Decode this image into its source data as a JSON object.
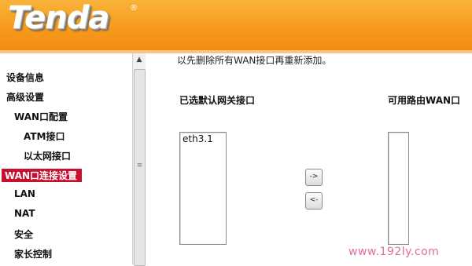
{
  "header": {
    "logo_text": "Tenda",
    "reg_mark": "®"
  },
  "sidebar": {
    "items": [
      {
        "label": "设备信息"
      },
      {
        "label": "高级设置"
      },
      {
        "label": "WAN口配置"
      },
      {
        "label": "ATM接口"
      },
      {
        "label": "以太网接口"
      },
      {
        "label": "WAN口连接设置",
        "active": true
      },
      {
        "label": "LAN"
      },
      {
        "label": "NAT"
      },
      {
        "label": "安全"
      },
      {
        "label": "家长控制"
      }
    ],
    "scroll_up_glyph": "▲",
    "scroll_grip_glyph": "≡"
  },
  "main": {
    "note": "以先删除所有WAN接口再重新添加。",
    "selected_label": "已选默认网关接口",
    "available_label": "可用路由WAN口",
    "selected_options": [
      "eth3.1"
    ],
    "available_options": [],
    "add_button": "->",
    "remove_button": "<-"
  },
  "watermark": "www.192ly.com",
  "colors": {
    "header": "#f79a1c",
    "active_nav": "#c8102e",
    "watermark": "#e26aa2"
  }
}
